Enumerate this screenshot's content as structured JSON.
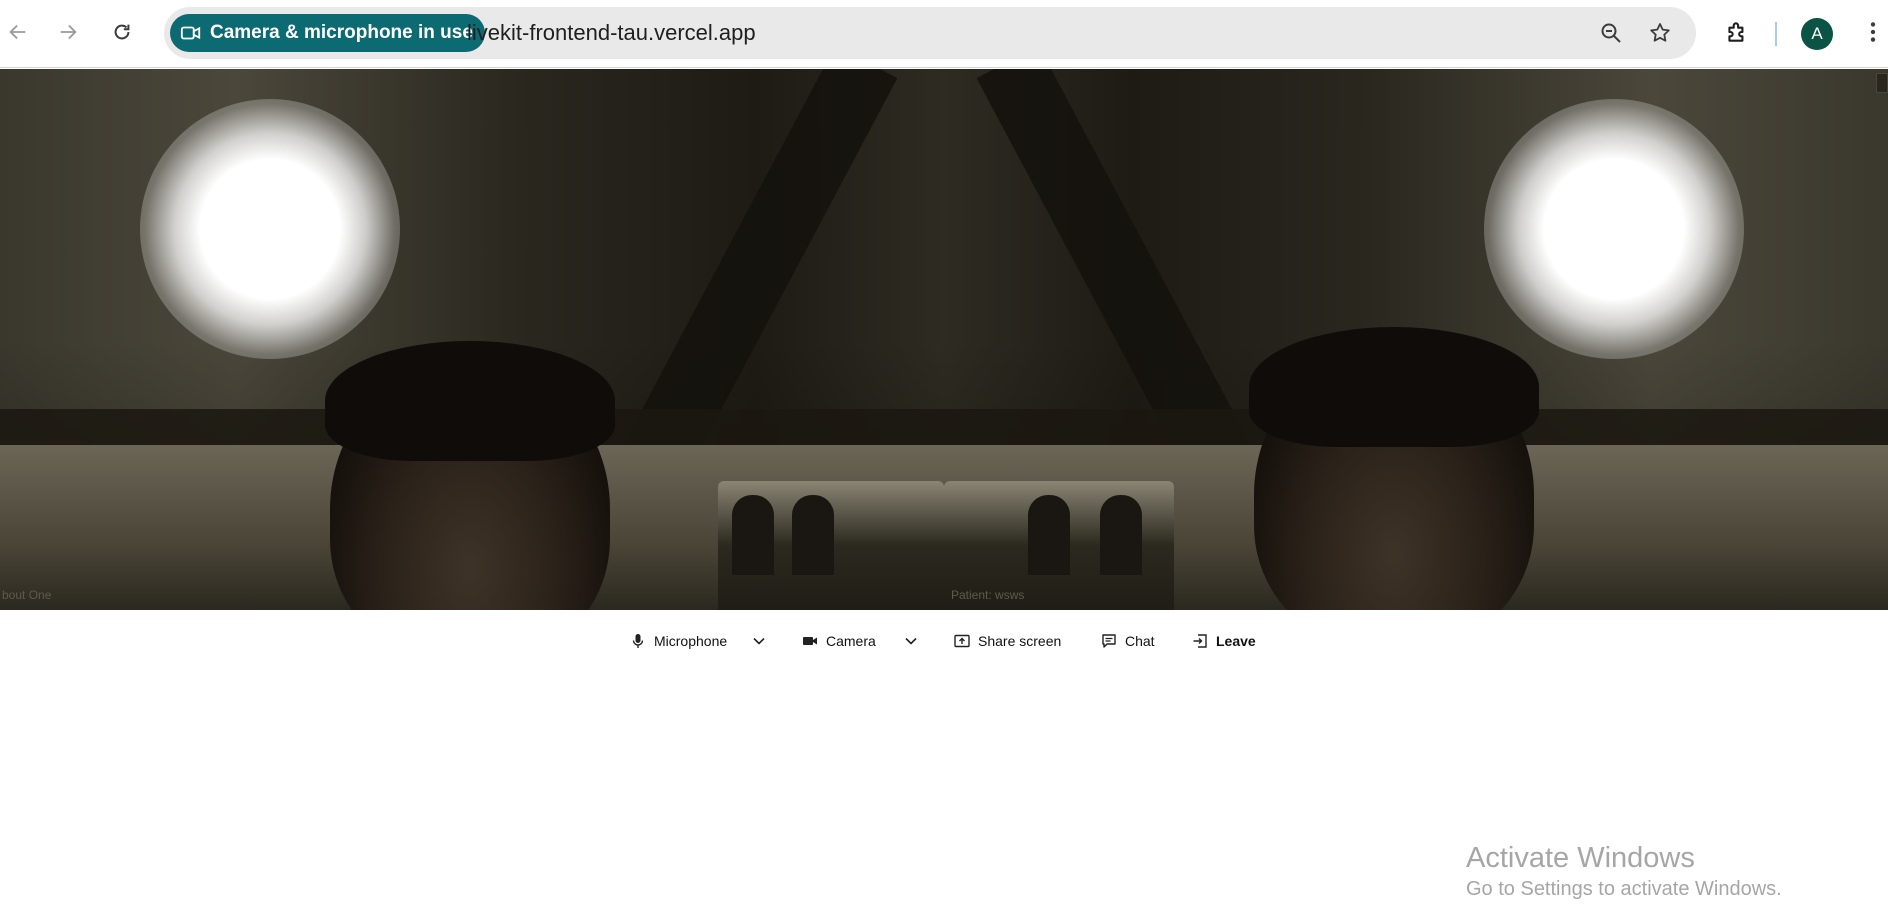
{
  "browser": {
    "camera_chip_label": "Camera & microphone in use",
    "url": "livekit-frontend-tau.vercel.app",
    "profile_initial": "A",
    "accent_color": "#0c6a72"
  },
  "video": {
    "tiles": [
      {
        "label": "bout One"
      },
      {
        "label": "Patient: wsws"
      }
    ]
  },
  "controls": {
    "microphone_label": "Microphone",
    "camera_label": "Camera",
    "share_screen_label": "Share screen",
    "chat_label": "Chat",
    "leave_label": "Leave"
  },
  "watermark": {
    "title": "Activate Windows",
    "subtitle": "Go to Settings to activate Windows."
  },
  "icons": [
    "back-arrow-icon",
    "forward-arrow-icon",
    "reload-icon",
    "video-camera-icon",
    "zoom-out-icon",
    "star-icon",
    "extensions-icon",
    "microphone-icon",
    "chevron-down-icon",
    "camera-icon",
    "share-screen-icon",
    "chat-icon",
    "leave-icon"
  ]
}
